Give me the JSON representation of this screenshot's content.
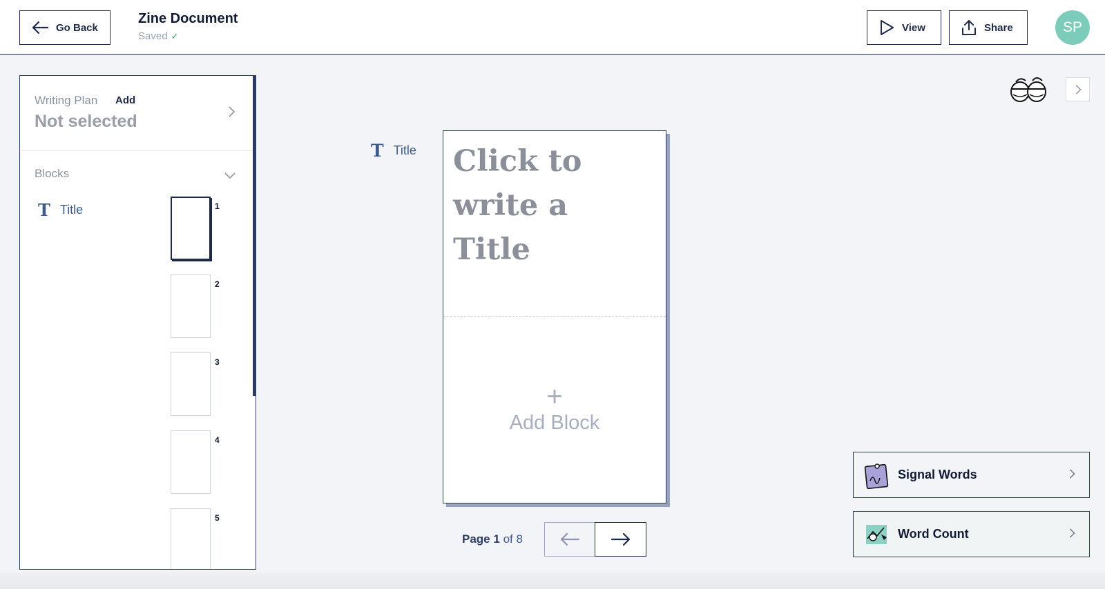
{
  "header": {
    "go_back_label": "Go Back",
    "document_title": "Zine Document",
    "save_status": "Saved",
    "view_label": "View",
    "share_label": "Share",
    "avatar_initials": "SP"
  },
  "sidebar": {
    "writing_plan_label": "Writing Plan",
    "writing_plan_add": "Add",
    "writing_plan_value": "Not selected",
    "blocks_label": "Blocks",
    "block_items": [
      {
        "label": "Title",
        "icon": "title-icon"
      }
    ],
    "page_thumbnails": [
      {
        "number": "1",
        "selected": true
      },
      {
        "number": "2",
        "selected": false
      },
      {
        "number": "3",
        "selected": false
      },
      {
        "number": "4",
        "selected": false
      },
      {
        "number": "5",
        "selected": false
      }
    ]
  },
  "canvas": {
    "block_side_label": "Title",
    "title_placeholder": "Click to write a Title",
    "add_block_plus": "+",
    "add_block_label": "Add Block"
  },
  "pager": {
    "prefix": "Page",
    "current": "1",
    "of_text": "of 8"
  },
  "tools": [
    {
      "label": "Signal Words",
      "icon": "sticky-note-icon"
    },
    {
      "label": "Word Count",
      "icon": "counting-icon"
    }
  ],
  "colors": {
    "primary": "#1e2a48",
    "accent": "#3d5a89",
    "avatar": "#7ccbbb",
    "saved_check": "#2c9a5c"
  }
}
